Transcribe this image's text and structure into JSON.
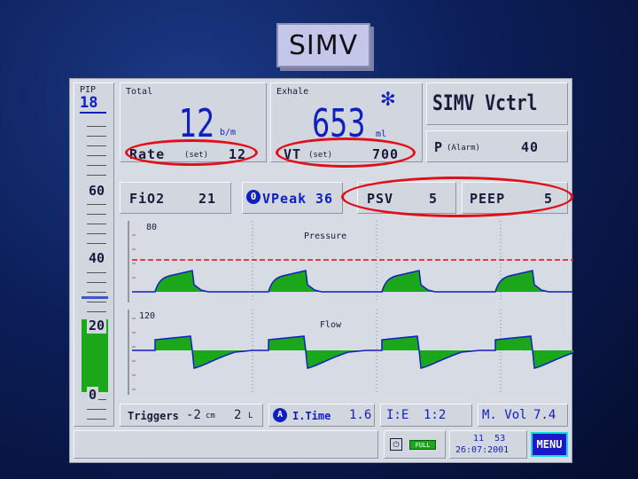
{
  "title": "SIMV",
  "left_scale": {
    "ppif_label": "PIP",
    "ppif_value": "18",
    "labels": [
      "60",
      "40",
      "20",
      "0"
    ],
    "fill_level": 0.28
  },
  "total": {
    "label": "Total",
    "value": "12",
    "unit": "b/m"
  },
  "exhale": {
    "label": "Exhale",
    "value": "653",
    "unit": "ml"
  },
  "mode": "SIMV Vctrl",
  "rate": {
    "label": "Rate",
    "sub": "(set)",
    "value": "12"
  },
  "vt": {
    "label": "VT",
    "sub": "(set)",
    "value": "700"
  },
  "p_alarm": {
    "label": "P",
    "sub": "(Alarm)",
    "value": "40"
  },
  "fio2": {
    "label": "FiO2",
    "value": "21"
  },
  "vpeak": {
    "label": "VPeak",
    "value": "36"
  },
  "psv": {
    "label": "PSV",
    "value": "5"
  },
  "peep": {
    "label": "PEEP",
    "value": "5"
  },
  "pressure_graph": {
    "label": "Pressure",
    "top_label": "80"
  },
  "flow_graph": {
    "label": "Flow",
    "top_label": "120"
  },
  "triggers": {
    "label": "Triggers",
    "value": "-2",
    "unit": "cm",
    "value2": "2",
    "unit2": "L"
  },
  "i_time": {
    "label": "I.Time",
    "value": "1.6"
  },
  "ie": {
    "label": "I:E",
    "value": "1:2"
  },
  "m_vol": {
    "label": "M. Vol",
    "value": "7.4"
  },
  "status": {
    "battery": "FULL",
    "time": "11  53",
    "date": "26:07:2001"
  },
  "menu_label": "MENU",
  "colors": {
    "waveform_fill": "#1aa81a",
    "waveform_line": "#1020c0",
    "alarm_line": "#e01010",
    "highlight": "#e0101a"
  }
}
